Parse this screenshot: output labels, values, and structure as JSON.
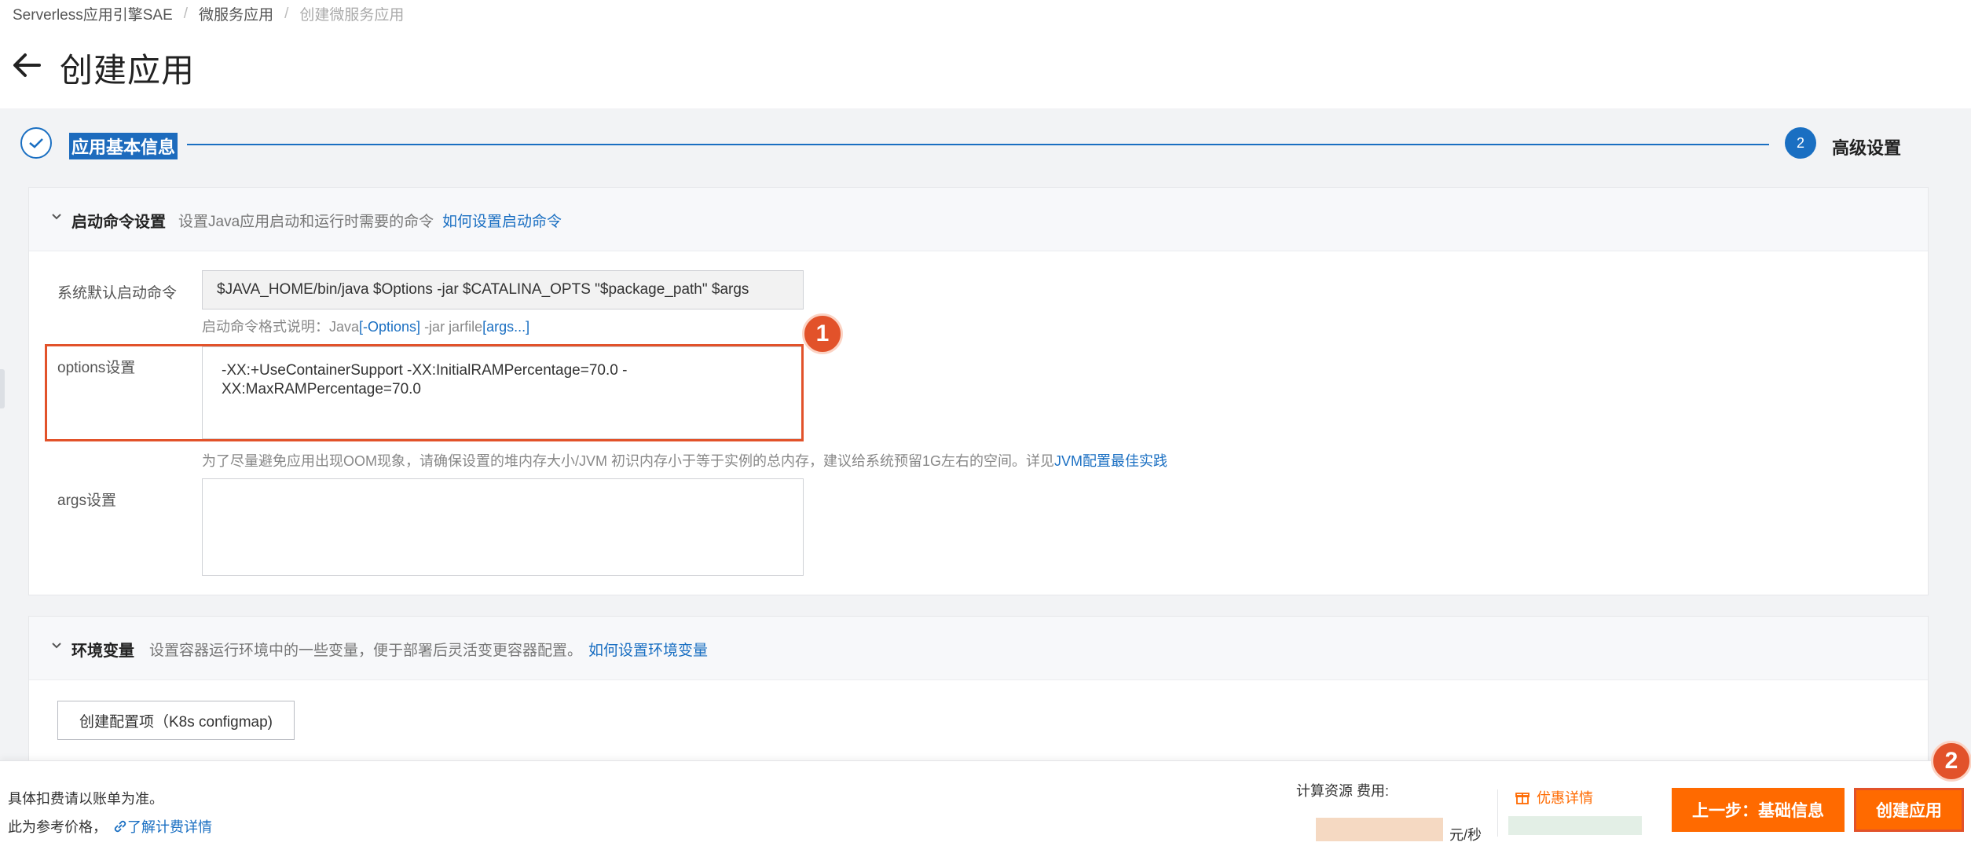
{
  "breadcrumb": [
    "Serverless应用引擎SAE",
    "微服务应用",
    "创建微服务应用"
  ],
  "page_title": "创建应用",
  "steps": {
    "step1_label": "应用基本信息",
    "step2_number": "2",
    "step2_label": "高级设置"
  },
  "startup_section": {
    "title": "启动命令设置",
    "desc": "设置Java应用启动和运行时需要的命令",
    "link": "如何设置启动命令",
    "default_label": "系统默认启动命令",
    "default_value": "$JAVA_HOME/bin/java $Options -jar $CATALINA_OPTS \"$package_path\" $args",
    "format_hint_prefix": "启动命令格式说明：Java",
    "format_hint_options": "[-Options]",
    "format_hint_mid": " -jar jarfile",
    "format_hint_args": "[args...]",
    "options_label": "options设置",
    "options_value": "-XX:+UseContainerSupport -XX:InitialRAMPercentage=70.0 -XX:MaxRAMPercentage=70.0",
    "oom_hint": "为了尽量避免应用出现OOM现象，请确保设置的堆内存大小/JVM 初识内存小于等于实例的总内存，建议给系统预留1G左右的空间。详见",
    "oom_link": "JVM配置最佳实践",
    "args_label": "args设置",
    "args_value": ""
  },
  "env_section": {
    "title": "环境变量",
    "desc": "设置容器运行环境中的一些变量，便于部署后灵活变更容器配置。",
    "link": "如何设置环境变量",
    "create_config_button": "创建配置项（K8s configmap)"
  },
  "annotations": {
    "badge1": "1",
    "badge2": "2"
  },
  "footer": {
    "note1": "具体扣费请以账单为准。",
    "note2": "此为参考价格，",
    "billing_link": "了解计费详情",
    "cost_label": "计算资源 费用:",
    "unit": "元/秒",
    "discount_link": "优惠详情",
    "prev_button": "上一步：基础信息",
    "create_button": "创建应用"
  },
  "colors": {
    "primary": "#1a6fc2",
    "accent": "#ff6a00",
    "highlight": "#e2522a"
  }
}
